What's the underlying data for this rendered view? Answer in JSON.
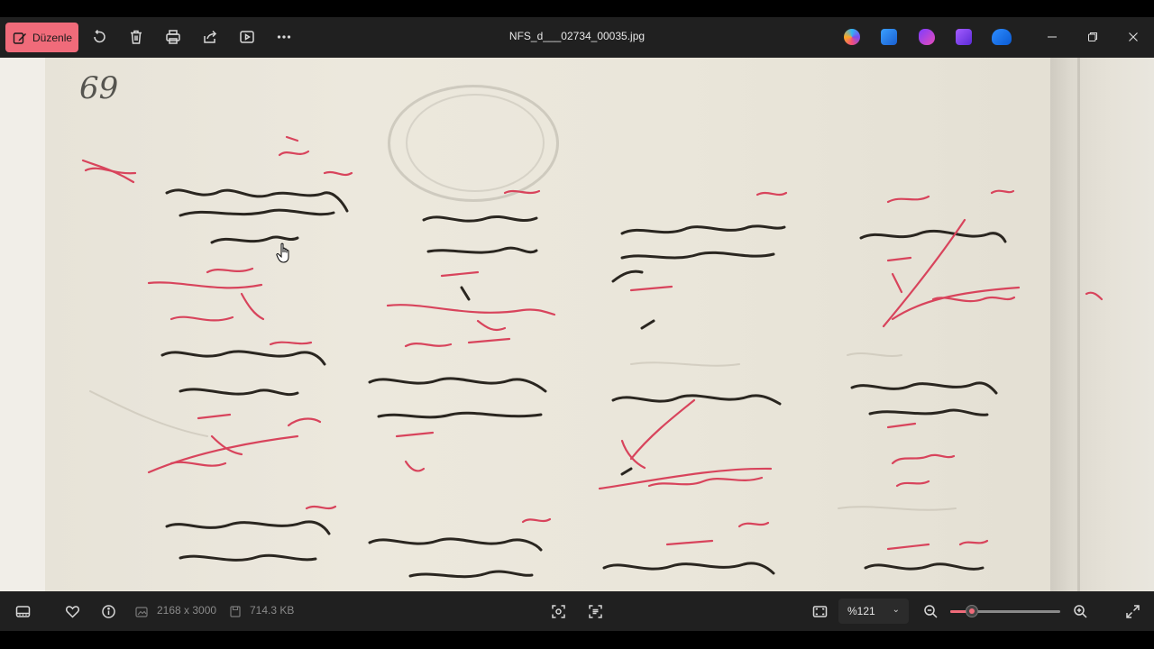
{
  "toolbar": {
    "edit_label": "Düzenle",
    "file_name": "NFS_d___02734_00035.jpg",
    "icons": [
      "edit-icon",
      "rotate-icon",
      "delete-icon",
      "print-icon",
      "share-icon",
      "slideshow-icon",
      "more-icon"
    ],
    "app_icons": [
      "copilot-icon",
      "paint-icon",
      "clipchamp-icon",
      "video-editor-icon",
      "onedrive-icon"
    ]
  },
  "document": {
    "page_number": "69"
  },
  "status": {
    "dimensions": "2168 x 3000",
    "file_size": "714.3 KB",
    "zoom": "%121",
    "zoom_level_fraction": 0.2
  },
  "colors": {
    "accent": "#f06b7a",
    "toolbar_bg": "#202020",
    "paper": "#ebe7dc",
    "ink": "#2a2620",
    "red_ink": "#d8445c"
  }
}
